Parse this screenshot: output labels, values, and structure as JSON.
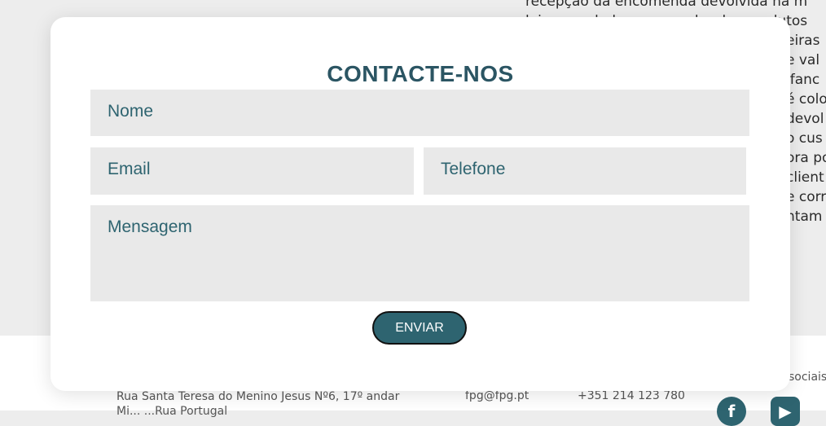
{
  "background_text": [
    "recepção da encomenda devolvida na m",
    "loja, reembolsamos o valor dos produtos",
    "eiras",
    "e val",
    "lfanc",
    "é colo",
    "devol",
    "o cus",
    "ora po",
    "client",
    "e corr",
    "ntam"
  ],
  "footer": {
    "address": "Rua Santa Teresa do Menino Jesus Nº6, 17º andar",
    "address_line2": "Mi... ...Rua Portugal",
    "email": "fpg@fpg.pt",
    "phone": "+351 214 123 780",
    "social_label": "sociais"
  },
  "modal": {
    "title": "CONTACTE-NOS",
    "fields": {
      "nome": "Nome",
      "email": "Email",
      "telefone": "Telefone",
      "mensagem": "Mensagem"
    },
    "submit_label": "ENVIAR"
  },
  "icons": {
    "facebook": "f",
    "youtube": "▶"
  }
}
